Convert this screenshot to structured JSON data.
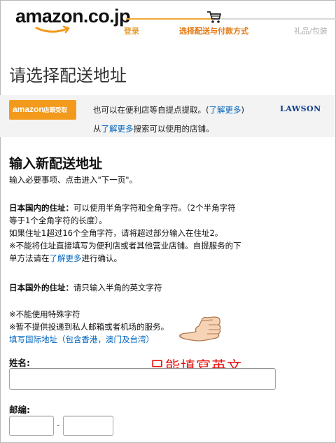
{
  "header": {
    "logo_text": "amazon.co.jp",
    "steps": [
      "登录",
      "选择配送与付款方式",
      "礼品/包装"
    ]
  },
  "page_title": "请选择配送地址",
  "pickup": {
    "badge_brand": "amazon",
    "badge_sub": "店頭受取",
    "line1_text": "也可以在便利店等自提点提取。(",
    "line1_link": "了解更多",
    "line1_end": ")",
    "line2_start": "从",
    "line2_link": "了解更多",
    "line2_end": "搜索可以使用的店铺。",
    "partner": "LAWSON"
  },
  "new_address": {
    "title": "输入新配送地址",
    "intro": "输入必要事项、点击进入\"下一页\"。",
    "jp_heading": "日本国内的住址：",
    "jp_line1": "可以使用半角字符和全角字符。（2个半角字符",
    "jp_line2": "等于1个全角字符的长度）。",
    "jp_line3": "如果住址1超过16个全角字符，请将超过部分输入在住址2。",
    "jp_line4": "※不能将住址直接填写为便利店或者其他营业店铺。自提服务的下",
    "jp_line5_start": "单方法请在",
    "jp_line5_link": "了解更多",
    "jp_line5_end": "进行确认。",
    "intl_heading": "日本国外的住址：",
    "intl_text": "请只输入半角的英文字符",
    "note1": "※不能使用特殊字符",
    "note2": "※暂不提供投递到私人邮箱或者机场的服务。",
    "intl_link": "填写国际地址（包含香港，澳门及台湾）"
  },
  "annotation": "只能填寫英文",
  "form": {
    "name_label": "姓名:",
    "name_value": "",
    "zip_label": "邮编:",
    "zip1_value": "",
    "zip_separator": "-",
    "zip2_value": ""
  },
  "colors": {
    "brand_orange": "#f39a1c",
    "link": "#0066c0",
    "annotation_red": "#e8100a",
    "lawson_blue": "#0f3c8c"
  },
  "icons": [
    "cart-icon",
    "smile-arrow-icon",
    "pointing-hand-icon"
  ]
}
